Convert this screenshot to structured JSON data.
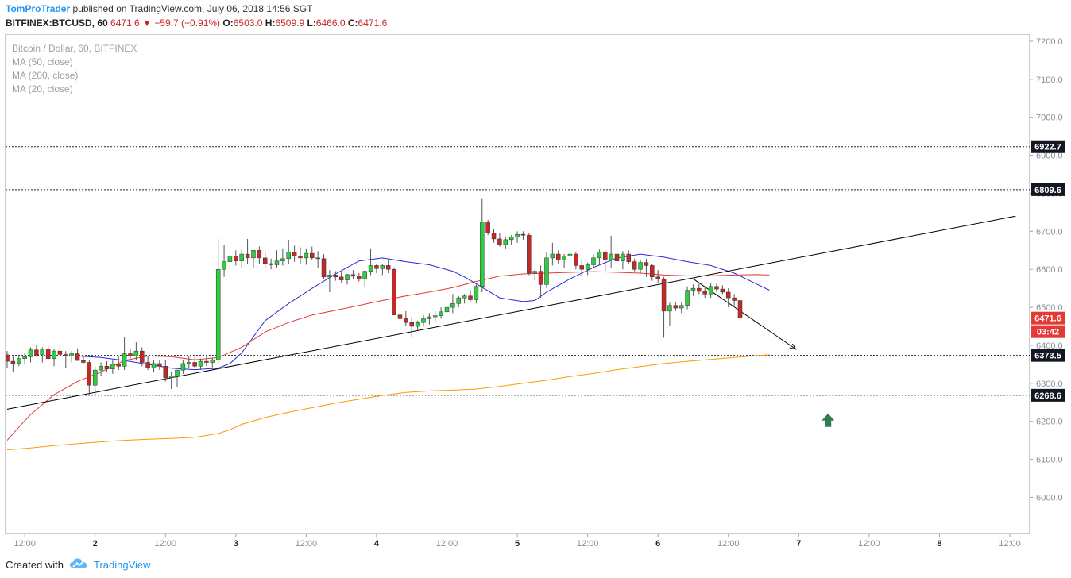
{
  "header": {
    "author": "TomProTrader",
    "published_text": "published on TradingView.com, July 06, 2018 14:56 SGT",
    "symbol": "BITFINEX:BTCUSD, 60",
    "last": "6471.6",
    "change": "−59.7 (−0.91%)",
    "o_label": "O:",
    "o_value": "6503.0",
    "h_label": "H:",
    "h_value": "6509.9",
    "l_label": "L:",
    "l_value": "6466.0",
    "c_label": "C:",
    "c_value": "6471.6"
  },
  "legend": {
    "title": "Bitcoin / Dollar, 60, BITFINEX",
    "ma50": "MA (50, close)",
    "ma200": "MA (200, close)",
    "ma20": "MA (20, close)"
  },
  "footer": {
    "created_with": "Created with",
    "brand": "TradingView"
  },
  "colors": {
    "up": "#2ecc40",
    "down": "#c62828",
    "ma20": "#2929d6",
    "ma50": "#e53935",
    "ma200": "#ff9800",
    "trend": "#000000",
    "badge_dark": "#131722",
    "badge_red": "#e53935",
    "arrow_green": "#2e7d4f",
    "accent": "#2196f3"
  },
  "chart_data": {
    "type": "candlestick",
    "y_axis": {
      "min": 5910,
      "max": 7220,
      "ticks": [
        7200.0,
        7100.0,
        7000.0,
        6900.0,
        6800.0,
        6700.0,
        6600.0,
        6500.0,
        6400.0,
        6300.0,
        6200.0,
        6100.0,
        6000.0
      ],
      "tick_labels": [
        "7200.0",
        "7100.0",
        "7000.0",
        "6900.0",
        "6800.0",
        "6700.0",
        "6600.0",
        "6500.0",
        "6400.0",
        "6300.0",
        "6200.0",
        "6100.0",
        "6000.0"
      ]
    },
    "x_axis": {
      "bar_min": 0,
      "bar_max": 144.5,
      "ticks": [
        {
          "bar": 3,
          "label": "12:00"
        },
        {
          "bar": 15,
          "label": "2"
        },
        {
          "bar": 27,
          "label": "12:00"
        },
        {
          "bar": 39,
          "label": "3"
        },
        {
          "bar": 51,
          "label": "12:00"
        },
        {
          "bar": 63,
          "label": "4"
        },
        {
          "bar": 75,
          "label": "12:00"
        },
        {
          "bar": 87,
          "label": "5"
        },
        {
          "bar": 99,
          "label": "12:00"
        },
        {
          "bar": 111,
          "label": "6"
        },
        {
          "bar": 123,
          "label": "12:00"
        },
        {
          "bar": 135,
          "label": "7"
        },
        {
          "bar": 147,
          "label": "12:00"
        },
        {
          "bar": 159,
          "label": "8"
        },
        {
          "bar": 171,
          "label": "12:00"
        }
      ]
    },
    "candles": [
      [
        6375,
        6385,
        6340,
        6358
      ],
      [
        6358,
        6370,
        6330,
        6352
      ],
      [
        6352,
        6372,
        6345,
        6365
      ],
      [
        6365,
        6380,
        6350,
        6370
      ],
      [
        6370,
        6395,
        6355,
        6388
      ],
      [
        6388,
        6402,
        6370,
        6375
      ],
      [
        6375,
        6395,
        6355,
        6390
      ],
      [
        6390,
        6398,
        6360,
        6365
      ],
      [
        6365,
        6390,
        6345,
        6385
      ],
      [
        6385,
        6402,
        6370,
        6376
      ],
      [
        6376,
        6385,
        6340,
        6372
      ],
      [
        6372,
        6385,
        6355,
        6378
      ],
      [
        6378,
        6392,
        6360,
        6360
      ],
      [
        6360,
        6372,
        6350,
        6355
      ],
      [
        6355,
        6360,
        6270,
        6295
      ],
      [
        6295,
        6345,
        6270,
        6335
      ],
      [
        6335,
        6355,
        6320,
        6345
      ],
      [
        6345,
        6358,
        6330,
        6338
      ],
      [
        6338,
        6360,
        6325,
        6350
      ],
      [
        6350,
        6372,
        6335,
        6345
      ],
      [
        6345,
        6422,
        6335,
        6378
      ],
      [
        6378,
        6392,
        6365,
        6372
      ],
      [
        6372,
        6408,
        6360,
        6385
      ],
      [
        6385,
        6395,
        6345,
        6355
      ],
      [
        6355,
        6372,
        6335,
        6340
      ],
      [
        6340,
        6360,
        6330,
        6352
      ],
      [
        6352,
        6362,
        6335,
        6345
      ],
      [
        6345,
        6362,
        6305,
        6315
      ],
      [
        6315,
        6330,
        6285,
        6320
      ],
      [
        6320,
        6335,
        6290,
        6335
      ],
      [
        6335,
        6360,
        6325,
        6352
      ],
      [
        6352,
        6372,
        6340,
        6355
      ],
      [
        6355,
        6368,
        6340,
        6345
      ],
      [
        6345,
        6365,
        6335,
        6358
      ],
      [
        6358,
        6375,
        6345,
        6355
      ],
      [
        6355,
        6368,
        6342,
        6362
      ],
      [
        6362,
        6680,
        6350,
        6600
      ],
      [
        6600,
        6665,
        6580,
        6620
      ],
      [
        6620,
        6640,
        6600,
        6635
      ],
      [
        6635,
        6650,
        6610,
        6622
      ],
      [
        6622,
        6655,
        6605,
        6640
      ],
      [
        6640,
        6680,
        6615,
        6630
      ],
      [
        6630,
        6650,
        6605,
        6650
      ],
      [
        6650,
        6660,
        6615,
        6630
      ],
      [
        6630,
        6645,
        6605,
        6615
      ],
      [
        6615,
        6628,
        6600,
        6612
      ],
      [
        6612,
        6650,
        6605,
        6622
      ],
      [
        6622,
        6655,
        6610,
        6628
      ],
      [
        6628,
        6678,
        6615,
        6645
      ],
      [
        6645,
        6662,
        6620,
        6635
      ],
      [
        6635,
        6658,
        6615,
        6630
      ],
      [
        6630,
        6655,
        6612,
        6642
      ],
      [
        6642,
        6660,
        6625,
        6630
      ],
      [
        6630,
        6648,
        6605,
        6628
      ],
      [
        6628,
        6640,
        6575,
        6580
      ],
      [
        6580,
        6598,
        6540,
        6585
      ],
      [
        6585,
        6595,
        6570,
        6580
      ],
      [
        6580,
        6592,
        6565,
        6572
      ],
      [
        6572,
        6588,
        6560,
        6586
      ],
      [
        6586,
        6598,
        6575,
        6582
      ],
      [
        6582,
        6590,
        6568,
        6575
      ],
      [
        6575,
        6598,
        6555,
        6595
      ],
      [
        6595,
        6655,
        6585,
        6610
      ],
      [
        6610,
        6615,
        6590,
        6602
      ],
      [
        6602,
        6615,
        6585,
        6610
      ],
      [
        6610,
        6625,
        6590,
        6600
      ],
      [
        6600,
        6605,
        6480,
        6480
      ],
      [
        6480,
        6500,
        6465,
        6470
      ],
      [
        6470,
        6490,
        6450,
        6460
      ],
      [
        6460,
        6475,
        6420,
        6450
      ],
      [
        6450,
        6465,
        6440,
        6460
      ],
      [
        6460,
        6480,
        6450,
        6470
      ],
      [
        6470,
        6485,
        6455,
        6475
      ],
      [
        6475,
        6490,
        6460,
        6478
      ],
      [
        6478,
        6500,
        6470,
        6488
      ],
      [
        6488,
        6525,
        6475,
        6500
      ],
      [
        6500,
        6535,
        6485,
        6510
      ],
      [
        6510,
        6530,
        6500,
        6525
      ],
      [
        6525,
        6535,
        6510,
        6530
      ],
      [
        6530,
        6545,
        6515,
        6520
      ],
      [
        6520,
        6560,
        6510,
        6555
      ],
      [
        6555,
        6785,
        6540,
        6725
      ],
      [
        6725,
        6730,
        6690,
        6695
      ],
      [
        6695,
        6705,
        6670,
        6680
      ],
      [
        6680,
        6695,
        6660,
        6665
      ],
      [
        6665,
        6685,
        6655,
        6678
      ],
      [
        6678,
        6690,
        6665,
        6685
      ],
      [
        6685,
        6700,
        6670,
        6692
      ],
      [
        6692,
        6700,
        6678,
        6690
      ],
      [
        6690,
        6695,
        6585,
        6590
      ],
      [
        6590,
        6600,
        6570,
        6595
      ],
      [
        6595,
        6610,
        6525,
        6560
      ],
      [
        6560,
        6645,
        6550,
        6630
      ],
      [
        6630,
        6670,
        6610,
        6640
      ],
      [
        6640,
        6650,
        6615,
        6625
      ],
      [
        6625,
        6640,
        6605,
        6635
      ],
      [
        6635,
        6648,
        6620,
        6640
      ],
      [
        6640,
        6645,
        6600,
        6610
      ],
      [
        6610,
        6625,
        6580,
        6600
      ],
      [
        6600,
        6618,
        6585,
        6612
      ],
      [
        6612,
        6640,
        6605,
        6630
      ],
      [
        6630,
        6652,
        6610,
        6645
      ],
      [
        6645,
        6650,
        6595,
        6625
      ],
      [
        6625,
        6688,
        6605,
        6640
      ],
      [
        6640,
        6670,
        6615,
        6622
      ],
      [
        6622,
        6648,
        6600,
        6640
      ],
      [
        6640,
        6650,
        6615,
        6620
      ],
      [
        6620,
        6628,
        6595,
        6600
      ],
      [
        6600,
        6625,
        6590,
        6618
      ],
      [
        6618,
        6628,
        6580,
        6610
      ],
      [
        6610,
        6615,
        6570,
        6580
      ],
      [
        6580,
        6598,
        6565,
        6575
      ],
      [
        6575,
        6580,
        6420,
        6490
      ],
      [
        6490,
        6512,
        6450,
        6505
      ],
      [
        6505,
        6515,
        6490,
        6498
      ],
      [
        6498,
        6512,
        6485,
        6505
      ],
      [
        6505,
        6555,
        6495,
        6545
      ],
      [
        6545,
        6560,
        6530,
        6550
      ],
      [
        6550,
        6562,
        6535,
        6542
      ],
      [
        6542,
        6555,
        6525,
        6535
      ],
      [
        6535,
        6565,
        6525,
        6555
      ],
      [
        6555,
        6562,
        6540,
        6548
      ],
      [
        6548,
        6558,
        6535,
        6540
      ],
      [
        6540,
        6550,
        6500,
        6525
      ],
      [
        6525,
        6535,
        6500,
        6518
      ],
      [
        6518,
        6520,
        6466,
        6471.6
      ]
    ],
    "series": [
      {
        "name": "MA (20, close)",
        "bars": [
          12,
          16,
          20,
          24,
          28,
          32,
          36,
          38,
          40,
          44,
          48,
          52,
          56,
          60,
          64,
          68,
          72,
          76,
          78,
          80,
          84,
          88,
          90,
          92,
          96,
          100,
          104,
          108,
          112,
          116,
          120,
          124,
          126,
          128,
          130
        ],
        "values": [
          6372,
          6368,
          6360,
          6350,
          6340,
          6336,
          6340,
          6352,
          6380,
          6465,
          6510,
          6550,
          6588,
          6622,
          6630,
          6620,
          6612,
          6595,
          6580,
          6562,
          6525,
          6515,
          6518,
          6540,
          6575,
          6605,
          6630,
          6640,
          6632,
          6620,
          6610,
          6590,
          6575,
          6560,
          6545
        ]
      },
      {
        "name": "MA (50, close)",
        "bars": [
          0,
          2,
          4,
          8,
          12,
          16,
          20,
          24,
          28,
          32,
          36,
          40,
          44,
          48,
          52,
          56,
          60,
          64,
          68,
          72,
          76,
          80,
          84,
          88,
          92,
          96,
          100,
          104,
          108,
          112,
          116,
          120,
          124,
          128,
          130
        ],
        "values": [
          6150,
          6185,
          6218,
          6270,
          6305,
          6330,
          6360,
          6372,
          6370,
          6362,
          6368,
          6395,
          6435,
          6460,
          6480,
          6492,
          6505,
          6518,
          6530,
          6540,
          6552,
          6568,
          6582,
          6588,
          6590,
          6592,
          6594,
          6592,
          6590,
          6585,
          6583,
          6583,
          6585,
          6586,
          6585
        ]
      },
      {
        "name": "MA (200, close)",
        "bars": [
          0,
          4,
          8,
          12,
          16,
          20,
          24,
          28,
          32,
          36,
          38,
          40,
          44,
          48,
          52,
          56,
          60,
          64,
          68,
          72,
          76,
          80,
          84,
          88,
          92,
          96,
          100,
          104,
          108,
          112,
          116,
          120,
          124,
          128,
          130
        ],
        "values": [
          6125,
          6130,
          6136,
          6141,
          6146,
          6150,
          6153,
          6155,
          6158,
          6168,
          6178,
          6192,
          6210,
          6224,
          6236,
          6248,
          6258,
          6268,
          6276,
          6280,
          6282,
          6285,
          6292,
          6300,
          6308,
          6318,
          6326,
          6336,
          6344,
          6352,
          6358,
          6363,
          6368,
          6373,
          6375
        ]
      }
    ],
    "horizontal_levels": [
      {
        "value": 6922.7,
        "label": "6922.7"
      },
      {
        "value": 6809.6,
        "label": "6809.6"
      },
      {
        "value": 6373.5,
        "label": "6373.5"
      },
      {
        "value": 6268.6,
        "label": "6268.6"
      }
    ],
    "last_price": {
      "value": 6471.6,
      "label": "6471.6",
      "countdown": "03:42"
    },
    "drawings": {
      "trendline": {
        "from": {
          "bar": 0,
          "value": 6232
        },
        "to": {
          "bar": 172,
          "value": 6740
        }
      },
      "arrow": {
        "from": {
          "bar": 117,
          "value": 6575
        },
        "to": {
          "bar": 134.5,
          "value": 6390
        }
      },
      "up_marker": {
        "bar": 140,
        "value": 6200
      }
    }
  }
}
